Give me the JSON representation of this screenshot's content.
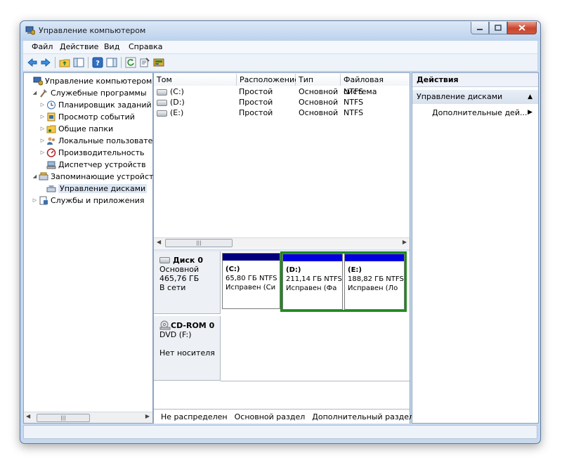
{
  "window": {
    "title": "Управление компьютером"
  },
  "menu": {
    "items": [
      "Файл",
      "Действие",
      "Вид",
      "Справка"
    ]
  },
  "tree": {
    "items": [
      {
        "label": "Управление компьютером (л",
        "level": 0
      },
      {
        "label": "Служебные программы",
        "level": 1
      },
      {
        "label": "Планировщик заданий",
        "level": 2
      },
      {
        "label": "Просмотр событий",
        "level": 2
      },
      {
        "label": "Общие папки",
        "level": 2
      },
      {
        "label": "Локальные пользовате",
        "level": 2
      },
      {
        "label": "Производительность",
        "level": 2
      },
      {
        "label": "Диспетчер устройств",
        "level": 2
      },
      {
        "label": "Запоминающие устройст",
        "level": 1
      },
      {
        "label": "Управление дисками",
        "level": 2
      },
      {
        "label": "Службы и приложения",
        "level": 1
      }
    ],
    "hscroll_thumb": "|||"
  },
  "volume_table": {
    "columns": [
      "Том",
      "Расположение",
      "Тип",
      "Файловая система"
    ],
    "rows": [
      {
        "volume": "(C:)",
        "layout": "Простой",
        "type": "Основной",
        "fs": "NTFS"
      },
      {
        "volume": "(D:)",
        "layout": "Простой",
        "type": "Основной",
        "fs": "NTFS"
      },
      {
        "volume": "(E:)",
        "layout": "Простой",
        "type": "Основной",
        "fs": "NTFS"
      }
    ],
    "hscroll_thumb": "|||"
  },
  "disks": [
    {
      "name": "Диск 0",
      "kind": "Основной",
      "size": "465,76 ГБ",
      "status": "В сети",
      "partitions": [
        {
          "label": "(C:)",
          "size": "65,80 ГБ NTFS",
          "status": "Исправен (Си"
        },
        {
          "label": "(D:)",
          "size": "211,14 ГБ NTFS",
          "status": "Исправен (Фа"
        },
        {
          "label": "(E:)",
          "size": "188,82 ГБ NTFS",
          "status": "Исправен (Ло"
        }
      ]
    },
    {
      "name": "CD-ROM 0",
      "kind": "DVD (F:)",
      "status": "Нет носителя"
    }
  ],
  "legend": {
    "unallocated": "Не распределен",
    "primary": "Основной раздел",
    "extended": "Дополнительный раздел"
  },
  "actions": {
    "header": "Действия",
    "group": "Управление дисками",
    "more": "Дополнительные дей..."
  },
  "colors": {
    "unallocated": "#000000",
    "primary": "#00007e",
    "extended": "#1f8a1f"
  }
}
